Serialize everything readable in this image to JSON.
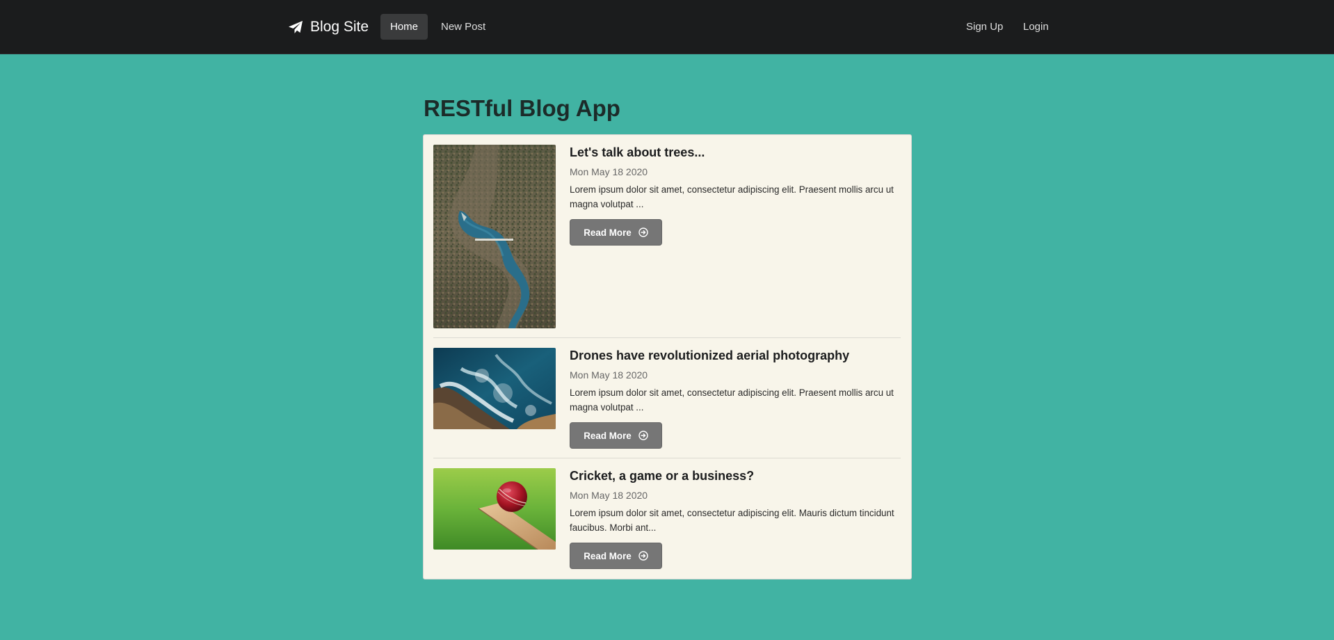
{
  "navbar": {
    "brand": "Blog Site",
    "brand_icon": "paper-plane-icon",
    "items": [
      {
        "label": "Home",
        "active": true
      },
      {
        "label": "New Post",
        "active": false
      }
    ],
    "right_items": [
      {
        "label": "Sign Up"
      },
      {
        "label": "Login"
      }
    ],
    "background": "#1b1c1d"
  },
  "main": {
    "title": "RESTful Blog App",
    "background": "#41b3a3",
    "card_background": "#f8f5ea"
  },
  "posts": [
    {
      "title": "Let's talk about trees...",
      "date": "Mon May 18 2020",
      "excerpt": "Lorem ipsum dolor sit amet, consectetur adipiscing elit. Praesent mollis arcu ut magna volutpat ...",
      "button": "Read More",
      "image": "aerial-forest-river-image"
    },
    {
      "title": "Drones have revolutionized aerial photography",
      "date": "Mon May 18 2020",
      "excerpt": "Lorem ipsum dolor sit amet, consectetur adipiscing elit. Praesent mollis arcu ut magna volutpat ...",
      "button": "Read More",
      "image": "aerial-ocean-coast-image"
    },
    {
      "title": "Cricket, a game or a business?",
      "date": "Mon May 18 2020",
      "excerpt": "Lorem ipsum dolor sit amet, consectetur adipiscing elit. Mauris dictum tincidunt faucibus. Morbi ant...",
      "button": "Read More",
      "image": "cricket-ball-bat-image"
    }
  ],
  "icons": {
    "read_more": "arrow-circle-right-icon"
  }
}
